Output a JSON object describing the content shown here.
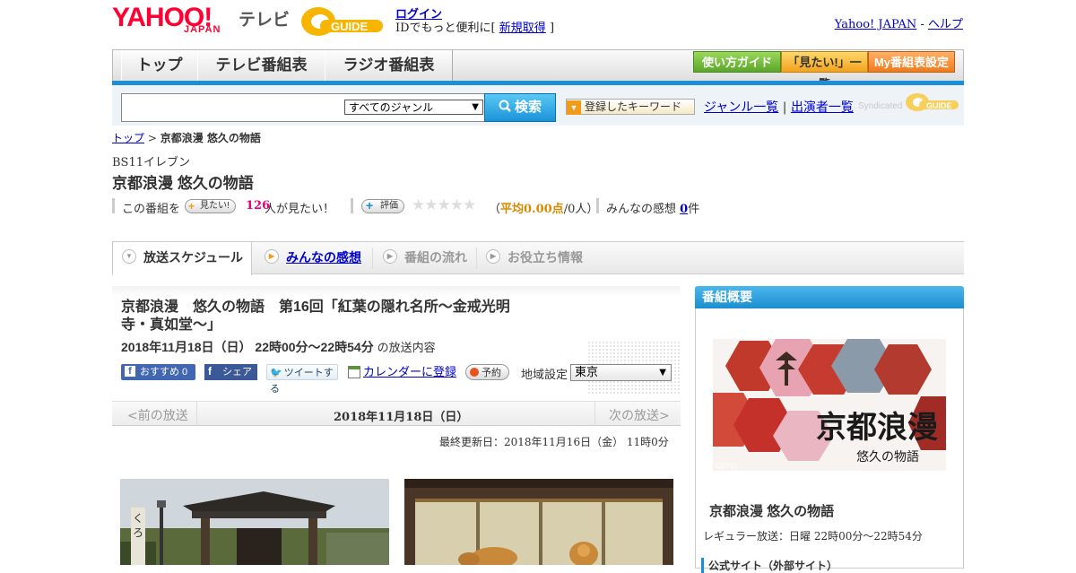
{
  "header": {
    "logo_text": "YAHOO!",
    "logo_sub": "JAPAN",
    "service_label": "テレビ",
    "gguide_logo": "G-GUIDE",
    "login_link": "ログイン",
    "login_prefix": "IDでもっと便利に[",
    "signup_link": "新規取得",
    "login_suffix": "]",
    "yahoo_japan_link": "Yahoo! JAPAN",
    "separator": " - ",
    "help_link": "ヘルプ"
  },
  "nav": {
    "tabs": [
      "トップ",
      "テレビ番組表",
      "ラジオ番組表"
    ],
    "right_buttons": [
      "使い方ガイド",
      "「見たい!」一覧",
      "My番組表設定"
    ]
  },
  "search": {
    "placeholder": "",
    "genre_selected": "すべてのジャンル",
    "search_button": "検索",
    "keyword_button": "登録したキーワード",
    "genre_list_link": "ジャンル一覧",
    "divider": "|",
    "cast_list_link": "出演者一覧",
    "syndicated_label": "Syndicated"
  },
  "breadcrumb": {
    "top_link": "トップ",
    "sep": " > ",
    "current": "京都浪漫 悠久の物語"
  },
  "program": {
    "channel": "BS11イレブン",
    "title": "京都浪漫 悠久の物語",
    "want_prefix": "この番組を",
    "want_button": "見たい!",
    "want_count": "126",
    "want_suffix": "人が見たい！",
    "rating_button": "評価",
    "rating_stars": 0,
    "rating_open": "（",
    "rating_avg": "平均0.00点",
    "rating_count": "/0人）",
    "impressions_label": "みんなの感想",
    "impressions_count": "0",
    "impressions_suffix": "件"
  },
  "tabs": [
    {
      "label": "放送スケジュール",
      "active": true
    },
    {
      "label": "みんなの感想",
      "link": true
    },
    {
      "label": "番組の流れ"
    },
    {
      "label": "お役立ち情報"
    }
  ],
  "episode": {
    "title": "京都浪漫　悠久の物語　第16回「紅葉の隠れ名所～金戒光明寺・真如堂～」",
    "date": "2018年11月18日（日）  22時00分～22時54分",
    "date_suffix": "の放送内容",
    "fb_recommend": "おすすめ 0",
    "fb_share": "シェア",
    "tweet": "ツイートする",
    "calendar": "カレンダーに登録",
    "reserve": "予約",
    "region_label": "地域設定",
    "region_value": "東京"
  },
  "pager": {
    "prev": "<前の放送",
    "current": "2018年11月18日（日）",
    "next": "次の放送>"
  },
  "updated": "最終更新日：2018年11月16日（金）  11時0分",
  "summary": {
    "heading": "番組概要",
    "image_caption": "©BS11",
    "image_title": "京都浪漫",
    "image_sub": "悠久の物語",
    "title": "京都浪漫 悠久の物語",
    "regular": "レギュラー放送：日曜 22時00分～22時54分",
    "official": "公式サイト（外部サイト）"
  },
  "colors": {
    "brand_red": "#ff0033",
    "nav_blue": "#1c8fd6",
    "link": "#0000cc",
    "pink_count": "#e4007f"
  }
}
